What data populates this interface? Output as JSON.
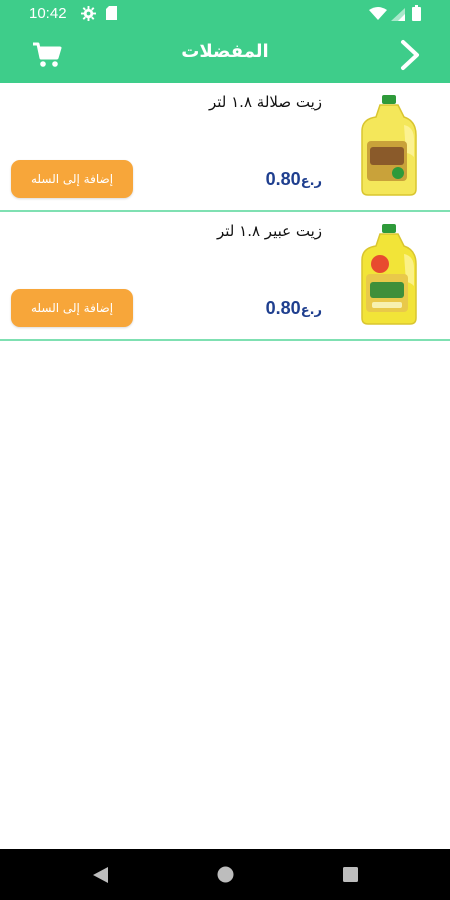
{
  "status_bar": {
    "time": "10:42",
    "icons": [
      "gear-icon",
      "sd-card-icon",
      "wifi-icon",
      "signal-icon",
      "battery-icon"
    ]
  },
  "app_bar": {
    "title": "المفضلات",
    "left_icon": "cart-icon",
    "right_icon": "chevron-right-icon",
    "color": "#3ecd8a"
  },
  "favorites": [
    {
      "name": "زيت صلالة ١.٨ لتر",
      "price": "0.80",
      "currency": "ر.ع",
      "add_label": "إضافة إلى السله",
      "image_icon": "oil-bottle-icon"
    },
    {
      "name": "زيت عبير ١.٨ لتر",
      "price": "0.80",
      "currency": "ر.ع",
      "add_label": "إضافة إلى السله",
      "image_icon": "oil-bottle-icon"
    }
  ],
  "colors": {
    "accent": "#3ecd8a",
    "button": "#f7a63a",
    "price": "#1f3f8f",
    "divider": "#7fe0b2"
  },
  "nav_bar": {
    "icons": [
      "back-triangle-icon",
      "home-circle-icon",
      "recents-square-icon"
    ]
  }
}
